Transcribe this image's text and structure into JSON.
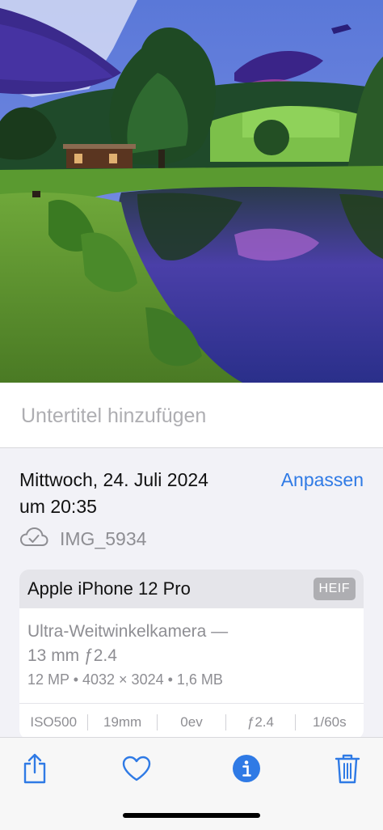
{
  "caption": {
    "placeholder": "Untertitel hinzufügen",
    "value": ""
  },
  "details": {
    "date_line1": "Mittwoch, 24. Juli 2024",
    "date_line2": "um 20:35",
    "adjust_label": "Anpassen",
    "filename": "IMG_5934",
    "cloud_icon": "cloud-check-icon"
  },
  "camera": {
    "device": "Apple iPhone 12 Pro",
    "format": "HEIF",
    "lens_line1": "Ultra-Weitwinkelkamera —",
    "lens_line2": "13 mm ƒ2.4",
    "specs": "12 MP  •  4032 × 3024  •  1,6 MB",
    "exif": [
      "ISO500",
      "19mm",
      "0ev",
      "ƒ2.4",
      "1/60s"
    ]
  },
  "toolbar": {
    "items": [
      "share-icon",
      "heart-icon",
      "info-icon",
      "trash-icon"
    ],
    "accent": "#2f7ae5"
  },
  "colors": {
    "accent": "#2f7ae5",
    "secondary_text": "#8e8e93"
  }
}
